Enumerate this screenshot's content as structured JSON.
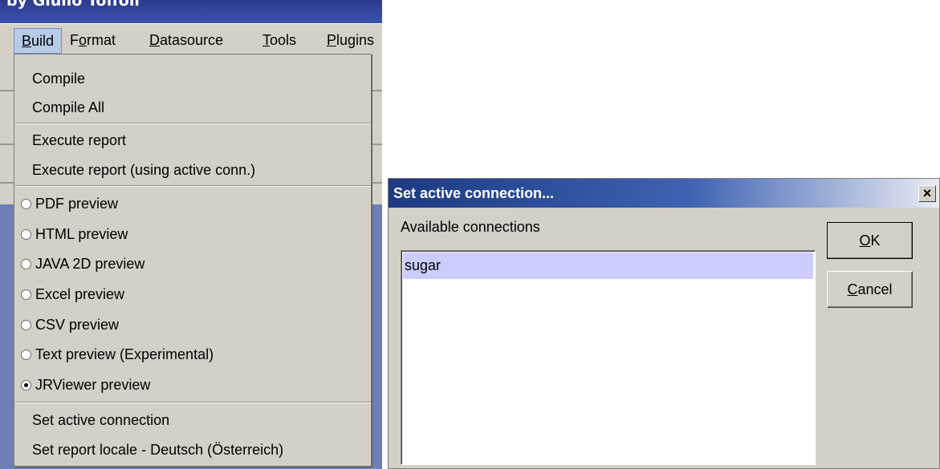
{
  "app": {
    "title": "by Giulio Toffoli",
    "menubar": [
      {
        "mnemonic": "B",
        "rest": "uild",
        "active": true
      },
      {
        "pre": "F",
        "mnemonic": "o",
        "rest": "rmat"
      },
      {
        "mnemonic": "D",
        "rest": "atasource"
      },
      {
        "mnemonic": "T",
        "rest": "ools"
      },
      {
        "mnemonic": "P",
        "rest": "lugins"
      }
    ]
  },
  "build_menu": {
    "compile": "Compile",
    "compile_all": "Compile All",
    "execute_report": "Execute report",
    "execute_report_active": "Execute report (using active conn.)",
    "pdf_preview": "PDF preview",
    "html_preview": "HTML preview",
    "java2d_preview": "JAVA 2D preview",
    "excel_preview": "Excel preview",
    "csv_preview": "CSV preview",
    "text_preview": "Text preview (Experimental)",
    "jrviewer_preview": "JRViewer preview",
    "selected_preview": "JRViewer preview",
    "set_active_connection": "Set active connection",
    "set_report_locale": "Set report locale - Deutsch (Österreich)"
  },
  "dialog": {
    "title": "Set active connection...",
    "close_glyph": "×",
    "available_label": "Available connections",
    "connections": [
      "sugar"
    ],
    "selected_connection": "sugar",
    "ok": {
      "mnemonic": "O",
      "rest": "K"
    },
    "cancel": {
      "mnemonic": "C",
      "rest": "ancel"
    }
  },
  "colors": {
    "window_bg": "#d4d0c8",
    "title_blue": "#1d3a82",
    "selection": "#ccccff",
    "menu_highlight": "#b8cbe8"
  }
}
